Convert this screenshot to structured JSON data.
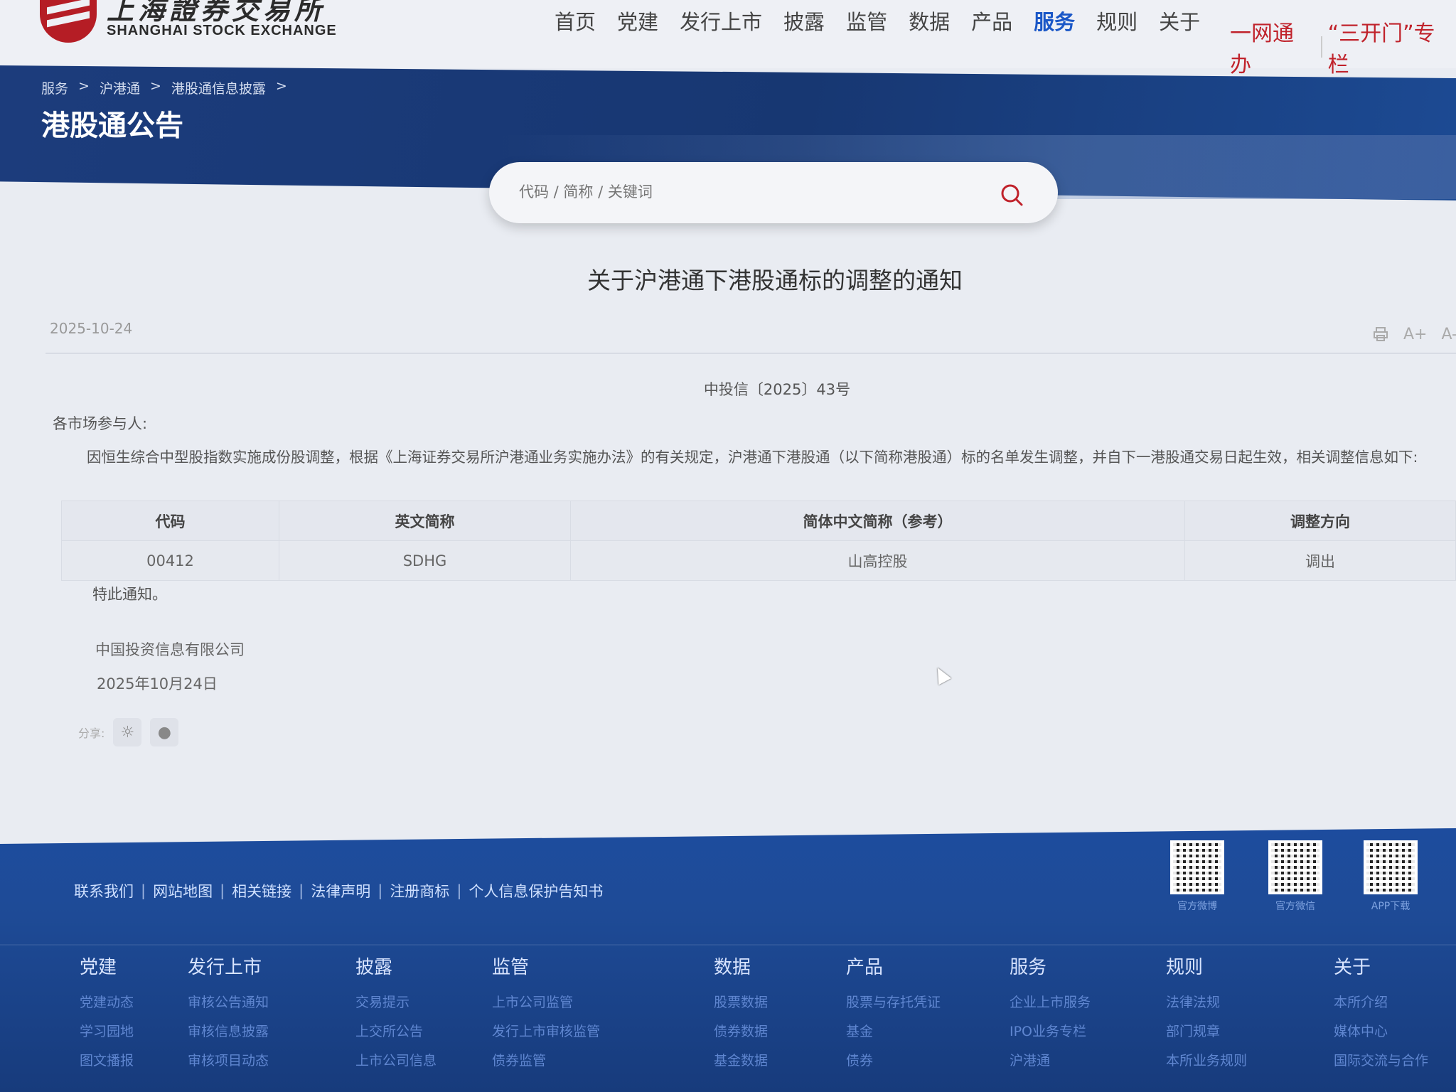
{
  "header": {
    "logo_cn": "上海證券交易所",
    "logo_en": "SHANGHAI STOCK EXCHANGE",
    "nav": [
      "首页",
      "党建",
      "发行上市",
      "披露",
      "监管",
      "数据",
      "产品",
      "服务",
      "规则",
      "关于"
    ],
    "active_nav": "服务",
    "link_one": "一网通办",
    "link_two": "“三开门”专栏"
  },
  "banner": {
    "breadcrumb": [
      "服务",
      "沪港通",
      "港股通信息披露"
    ],
    "title": "港股通公告"
  },
  "search": {
    "placeholder": "代码 / 简称 / 关键词"
  },
  "article": {
    "title": "关于沪港通下港股通标的调整的通知",
    "date": "2025-10-24",
    "doc_number": "中投信〔2025〕43号",
    "salutation": "各市场参与人:",
    "body": "因恒生综合中型股指数实施成份股调整，根据《上海证券交易所沪港通业务实施办法》的有关规定，沪港通下港股通（以下简称港股通）标的名单发生调整，并自下一港股通交易日起生效，相关调整信息如下:",
    "table": {
      "headers": [
        "代码",
        "英文简称",
        "简体中文简称（参考）",
        "调整方向"
      ],
      "rows": [
        [
          "00412",
          "SDHG",
          "山高控股",
          "调出"
        ]
      ]
    },
    "closing": "特此通知。",
    "company": "中国投资信息有限公司",
    "sign_date": "2025年10月24日",
    "share_label": "分享:",
    "tools": [
      "print-icon",
      "A+",
      "A-"
    ]
  },
  "footer": {
    "links": [
      "联系我们",
      "网站地图",
      "相关链接",
      "法律声明",
      "注册商标",
      "个人信息保护告知书"
    ],
    "qr": [
      "官方微博",
      "官方微信",
      "APP下载"
    ],
    "columns": [
      {
        "head": "党建",
        "items": [
          "党建动态",
          "学习园地",
          "图文播报"
        ]
      },
      {
        "head": "发行上市",
        "items": [
          "审核公告通知",
          "审核信息披露",
          "审核项目动态"
        ]
      },
      {
        "head": "披露",
        "items": [
          "交易提示",
          "上交所公告",
          "上市公司信息"
        ]
      },
      {
        "head": "监管",
        "items": [
          "上市公司监管",
          "发行上市审核监管",
          "债券监管"
        ]
      },
      {
        "head": "数据",
        "items": [
          "股票数据",
          "债券数据",
          "基金数据"
        ]
      },
      {
        "head": "产品",
        "items": [
          "股票与存托凭证",
          "基金",
          "债券"
        ]
      },
      {
        "head": "服务",
        "items": [
          "企业上市服务",
          "IPO业务专栏",
          "沪港通"
        ]
      },
      {
        "head": "规则",
        "items": [
          "法律法规",
          "部门规章",
          "本所业务规则"
        ]
      },
      {
        "head": "关于",
        "items": [
          "本所介绍",
          "媒体中心",
          "国际交流与合作"
        ]
      }
    ]
  }
}
